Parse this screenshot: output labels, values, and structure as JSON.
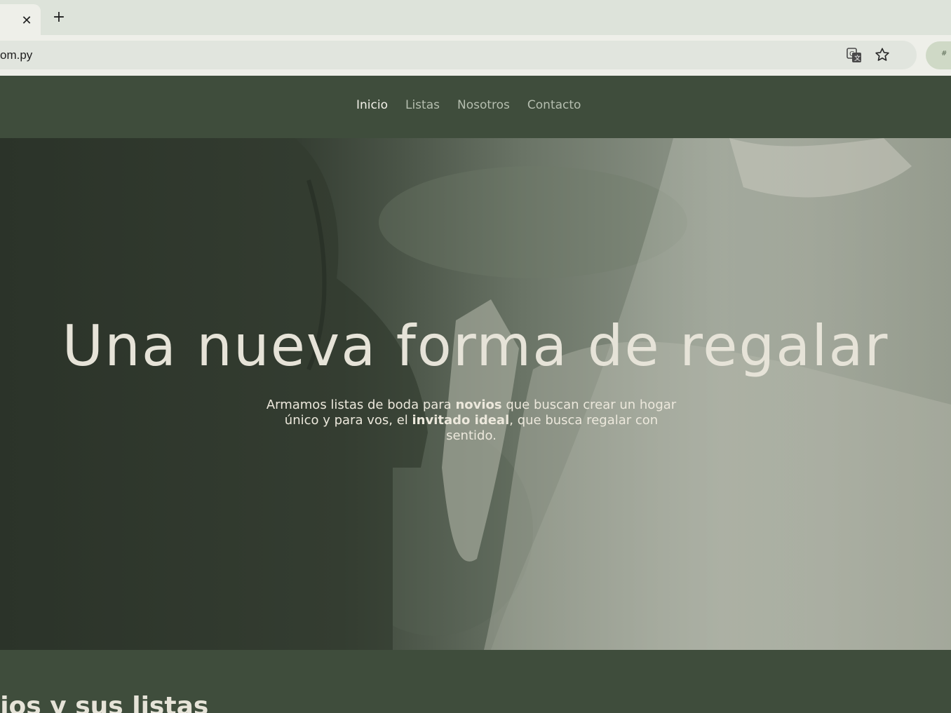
{
  "browser": {
    "tab_close_icon": "close-icon",
    "new_tab_icon": "plus-icon",
    "url": "om.py",
    "translate_icon": "translate-icon",
    "bookmark_icon": "star-icon"
  },
  "nav": {
    "items": [
      {
        "label": "Inicio",
        "active": true
      },
      {
        "label": "Listas",
        "active": false
      },
      {
        "label": "Nosotros",
        "active": false
      },
      {
        "label": "Contacto",
        "active": false
      }
    ]
  },
  "hero": {
    "title": "Una nueva forma de regalar",
    "subtitle_part1": "Armamos listas de boda para ",
    "subtitle_bold1": "novios",
    "subtitle_part2": " que buscan crear un hogar único y para vos, el ",
    "subtitle_bold2": "invitado ideal",
    "subtitle_part3": ", que busca regalar con sentido."
  },
  "section": {
    "title": "ovios y sus listas"
  },
  "colors": {
    "nav_bg": "#3f4d3c",
    "text_light": "#e6e3d8",
    "nav_inactive": "#b5beaf"
  }
}
